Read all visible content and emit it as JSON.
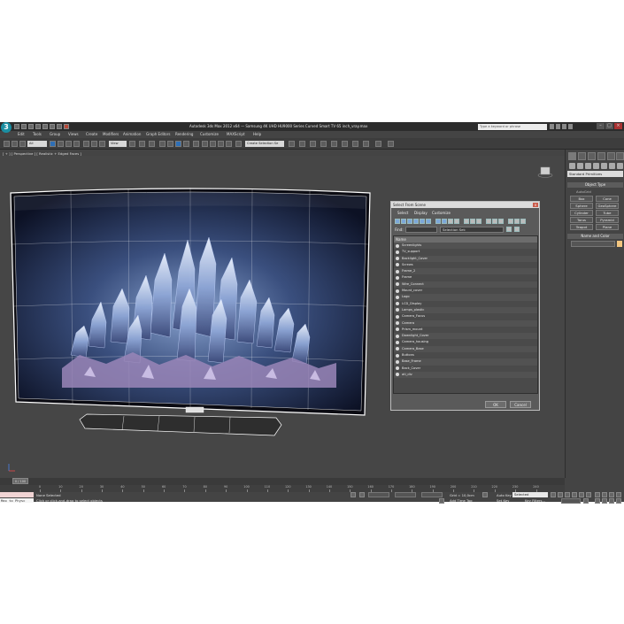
{
  "app": {
    "window_title": "Autodesk 3ds Max 2012 x64 — Samsung 4K UHD HU9000 Series Curved Smart TV 65 inch_vray.max",
    "search_placeholder": "Type a keyword or phrase"
  },
  "menu": [
    "Edit",
    "Tools",
    "Group",
    "Views",
    "Create",
    "Modifiers",
    "Animation",
    "Graph Editors",
    "Rendering",
    "Customize",
    "MAXScript",
    "Help"
  ],
  "toolbar": {
    "selection_filter": "All",
    "ref_coord": "View",
    "named_selection": "Create Selection Se"
  },
  "viewport": {
    "label": "[ + ] [ Perspective ] [ Realistic + Edged Faces ]"
  },
  "dialog": {
    "title": "Select From Scene",
    "menu": [
      "Select",
      "Display",
      "Customize"
    ],
    "find_label": "Find:",
    "selection_set_label": "Selection Set:",
    "column_header": "Name",
    "items": [
      "Screenlights",
      "TV_support",
      "Backlight_Cover",
      "Screws",
      "Frame_2",
      "Frame",
      "Wire_Connect",
      "Mount_cover",
      "Logo",
      "LCD_Display",
      "Lamps_plastic",
      "Camera_Focus",
      "Camera",
      "Prism_mount",
      "Downlight_Cover",
      "Camera_housing",
      "Camera_Base",
      "Buttons",
      "Base_Frame",
      "Back_Cover",
      "ati_div"
    ],
    "ok_label": "OK",
    "cancel_label": "Cancel"
  },
  "command_panel": {
    "category": "Standard Primitives",
    "object_type_header": "Object Type",
    "autogrid_label": "AutoGrid",
    "object_types": [
      "Box",
      "Cone",
      "Sphere",
      "GeoSphere",
      "Cylinder",
      "Tube",
      "Torus",
      "Pyramid",
      "Teapot",
      "Plane"
    ],
    "name_color_header": "Name and Color",
    "swatch_color": "#f2c57f"
  },
  "timeline": {
    "frame_counter": "0 / 100",
    "ruler_ticks": [
      "0",
      "10",
      "20",
      "30",
      "40",
      "50",
      "60",
      "70",
      "80",
      "90",
      "100",
      "110",
      "120",
      "130",
      "140",
      "150",
      "160",
      "170",
      "180",
      "190",
      "200",
      "210",
      "220",
      "230",
      "240"
    ]
  },
  "status": {
    "maxscript_text": "Max to Physc",
    "selection_status": "None Selected",
    "prompt": "Click or click-and-drag to select objects",
    "grid": "Grid = 10,0cm",
    "add_time_tag": "Add Time Tag",
    "auto_key": "Auto Key",
    "set_key": "Set Key",
    "key_filter": "Selected",
    "key_filters_btn": "Key Filters..."
  }
}
